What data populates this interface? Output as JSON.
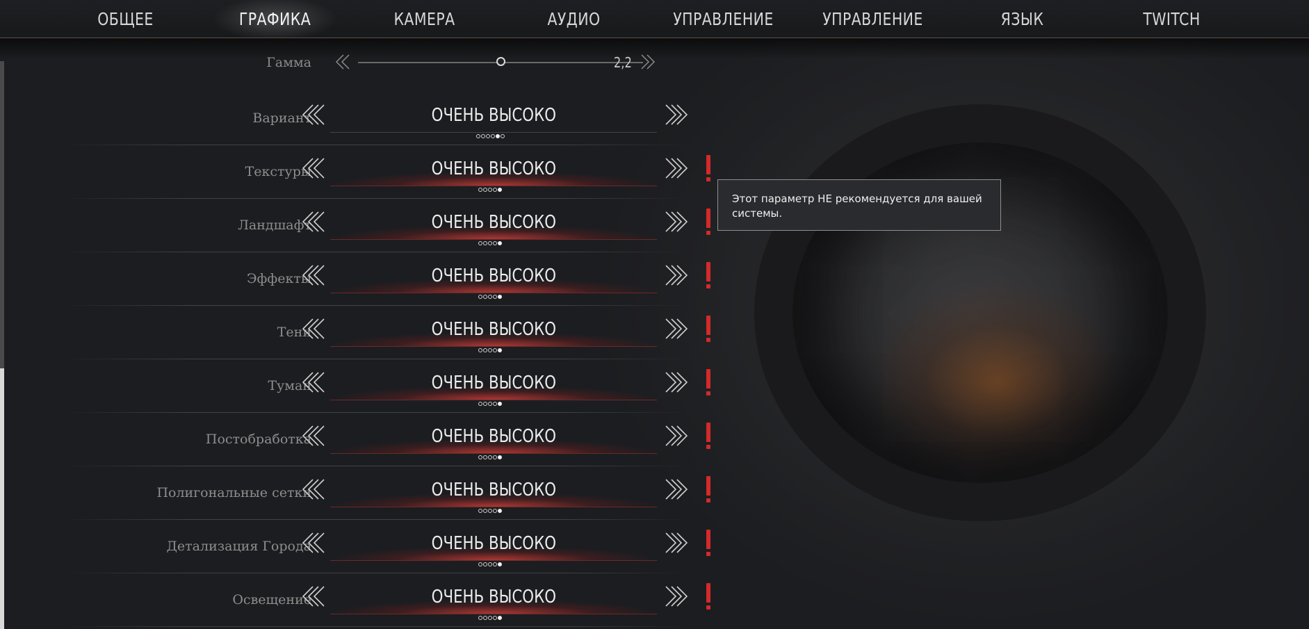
{
  "tabs": [
    {
      "label": "ОБЩЕЕ",
      "active": false
    },
    {
      "label": "ГРАФИКА",
      "active": true
    },
    {
      "label": "КАМЕРА",
      "active": false
    },
    {
      "label": "АУДИО",
      "active": false
    },
    {
      "label": "УПРАВЛЕНИЕ",
      "active": false
    },
    {
      "label": "УПРАВЛЕНИЕ",
      "active": false
    },
    {
      "label": "ЯЗЫК",
      "active": false
    },
    {
      "label": "TWITCH",
      "active": false
    }
  ],
  "gamma": {
    "label": "Гамма",
    "value": "2,2",
    "level": 0.5
  },
  "settings": [
    {
      "label": "Вариант",
      "value": "ОЧЕНЬ ВЫСОКО",
      "warning": false,
      "dots": 6,
      "selected": 5
    },
    {
      "label": "Текстуры",
      "value": "ОЧЕНЬ ВЫСОКО",
      "warning": true,
      "dots": 5,
      "selected": 5
    },
    {
      "label": "Ландшафт",
      "value": "ОЧЕНЬ ВЫСОКО",
      "warning": true,
      "dots": 5,
      "selected": 5
    },
    {
      "label": "Эффекты",
      "value": "ОЧЕНЬ ВЫСОКО",
      "warning": true,
      "dots": 5,
      "selected": 5
    },
    {
      "label": "Тени",
      "value": "ОЧЕНЬ ВЫСОКО",
      "warning": true,
      "dots": 5,
      "selected": 5
    },
    {
      "label": "Туман",
      "value": "ОЧЕНЬ ВЫСОКО",
      "warning": true,
      "dots": 5,
      "selected": 5
    },
    {
      "label": "Постобработка",
      "value": "ОЧЕНЬ ВЫСОКО",
      "warning": true,
      "dots": 5,
      "selected": 5
    },
    {
      "label": "Полигональные сетки",
      "value": "ОЧЕНЬ ВЫСОКО",
      "warning": true,
      "dots": 5,
      "selected": 5
    },
    {
      "label": "Детализация Города",
      "value": "ОЧЕНЬ ВЫСОКО",
      "warning": true,
      "dots": 5,
      "selected": 5
    },
    {
      "label": "Освещение",
      "value": "ОЧЕНЬ ВЫСОКО",
      "warning": true,
      "dots": 5,
      "selected": 5
    }
  ],
  "tooltip": {
    "text": "Этот параметр НЕ рекомендуется для вашей системы."
  },
  "icons": {
    "arrow_left": "chevron-triple-left-icon",
    "arrow_right": "chevron-triple-right-icon",
    "warning": "exclamation-icon"
  },
  "colors": {
    "warning": "#d42a2a",
    "highlight": "#c83c37",
    "tooltip_border": "#8f8f8f"
  }
}
